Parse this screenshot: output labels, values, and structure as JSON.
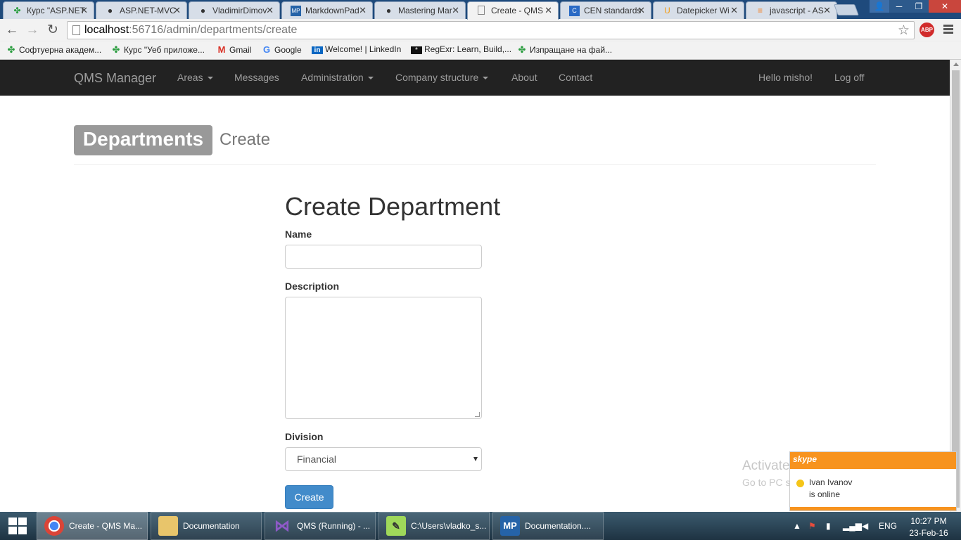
{
  "browser": {
    "tabs": [
      {
        "title": "Курс \"ASP.NET",
        "icon": "telerik-icon"
      },
      {
        "title": "ASP.NET-MVC",
        "icon": "github-icon"
      },
      {
        "title": "VladimirDimov",
        "icon": "github-icon"
      },
      {
        "title": "MarkdownPad",
        "icon": "markdownpad-icon"
      },
      {
        "title": "Mastering Mar",
        "icon": "github-icon"
      },
      {
        "title": "Create - QMS",
        "icon": "page-icon"
      },
      {
        "title": "CEN standards",
        "icon": "cen-icon"
      },
      {
        "title": "Datepicker Wi",
        "icon": "jqueryui-icon"
      },
      {
        "title": "javascript - AS",
        "icon": "stackoverflow-icon"
      }
    ],
    "url_host": "localhost",
    "url_path": ":56716/admin/departments/create",
    "bookmarks": [
      {
        "label": "Софтуерна академ...",
        "icon": "telerik-icon"
      },
      {
        "label": "Курс \"Уеб приложе...",
        "icon": "telerik-icon"
      },
      {
        "label": "Gmail",
        "icon": "gmail-icon"
      },
      {
        "label": "Google",
        "icon": "google-icon"
      },
      {
        "label": "Welcome! | LinkedIn",
        "icon": "linkedin-icon"
      },
      {
        "label": "RegExr: Learn, Build,...",
        "icon": "regexr-icon"
      },
      {
        "label": "Изпращане на фай...",
        "icon": "telerik-icon"
      }
    ],
    "abp_label": "ABP"
  },
  "navbar": {
    "brand": "QMS Manager",
    "items": [
      "Areas",
      "Messages",
      "Administration",
      "Company structure",
      "About",
      "Contact"
    ],
    "greeting": "Hello misho!",
    "logoff": "Log off"
  },
  "page": {
    "section_label": "Departments",
    "section_sub": "Create",
    "form_title": "Create Department",
    "name_label": "Name",
    "name_value": "",
    "description_label": "Description",
    "description_value": "",
    "division_label": "Division",
    "division_selected": "Financial",
    "submit_label": "Create"
  },
  "watermark": {
    "line1": "Activate Windows",
    "line2": "Go to PC settings to activate Windows."
  },
  "skype": {
    "brand": "skype",
    "contact": "Ivan Ivanov",
    "status": "is online"
  },
  "taskbar": {
    "items": [
      {
        "label": "Create - QMS Ma...",
        "icon": "chrome-icon"
      },
      {
        "label": "Documentation",
        "icon": "folder-icon"
      },
      {
        "label": "QMS (Running) - ...",
        "icon": "visual-studio-icon"
      },
      {
        "label": "C:\\Users\\vladko_s...",
        "icon": "notepad-plus-icon"
      },
      {
        "label": "Documentation....",
        "icon": "markdownpad-icon"
      }
    ],
    "language": "ENG",
    "time": "10:27 PM",
    "date": "23-Feb-16"
  },
  "colors": {
    "navbar_bg": "#222222",
    "primary_button": "#428bca",
    "section_label_bg": "#999999",
    "skype_orange": "#f7931e"
  }
}
